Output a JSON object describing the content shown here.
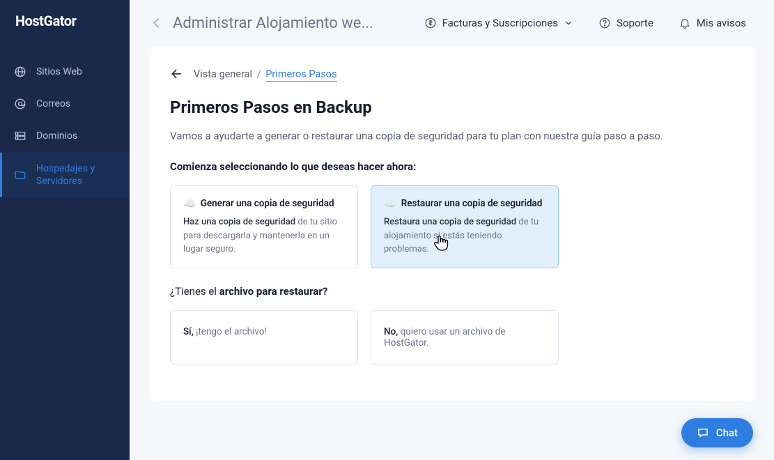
{
  "brand": "HostGator",
  "sidebar": {
    "items": [
      {
        "label": "Sitios Web"
      },
      {
        "label": "Correos"
      },
      {
        "label": "Dominios"
      },
      {
        "label": "Hospedajes y Servidores"
      }
    ]
  },
  "topbar": {
    "title": "Administrar Alojamiento we...",
    "billing": "Facturas y Suscripciones",
    "support": "Soporte",
    "notices": "Mis avisos"
  },
  "breadcrumb": {
    "root": "Vista general",
    "current": "Primeros Pasos"
  },
  "page": {
    "title": "Primeros Pasos en Backup",
    "desc": "Vamos a ayudarte a generar o restaurar una copia de seguridad para tu plan con nuestra guía paso a paso.",
    "section1": "Comienza seleccionando lo que deseas hacer ahora:",
    "generate": {
      "title": "Generar una copia de seguridad",
      "desc_strong": "Haz una copia de seguridad",
      "desc_rest": " de tu sitio para descargarla y mantenerla en un lugar seguro."
    },
    "restore": {
      "title": "Restaurar una copia de seguridad",
      "desc_strong": "Restaura una copia de seguridad",
      "desc_rest": " de tu alojamiento si estás teniendo problemas."
    },
    "question_light": "¿Tienes el ",
    "question_bold": "archivo para restaurar?",
    "yes_lead": "Sí,",
    "yes_rest": " ¡tengo el archivo!",
    "no_lead": "No,",
    "no_rest": " quiero usar un archivo de HostGator."
  },
  "chat": "Chat"
}
